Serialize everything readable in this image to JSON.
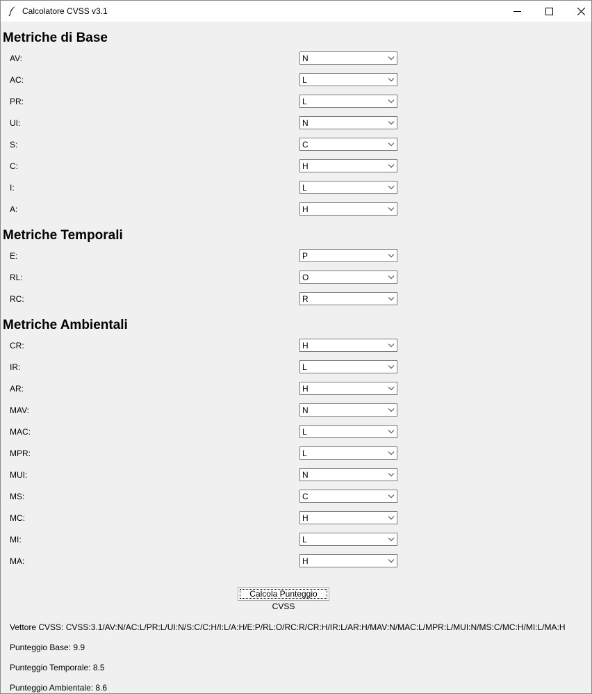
{
  "window": {
    "title": "Calcolatore CVSS v3.1"
  },
  "sections": {
    "base": {
      "heading": "Metriche di Base",
      "fields": [
        {
          "label": "AV:",
          "value": "N"
        },
        {
          "label": "AC:",
          "value": "L"
        },
        {
          "label": "PR:",
          "value": "L"
        },
        {
          "label": "UI:",
          "value": "N"
        },
        {
          "label": "S:",
          "value": "C"
        },
        {
          "label": "C:",
          "value": "H"
        },
        {
          "label": "I:",
          "value": "L"
        },
        {
          "label": "A:",
          "value": "H"
        }
      ]
    },
    "temporal": {
      "heading": "Metriche Temporali",
      "fields": [
        {
          "label": "E:",
          "value": "P"
        },
        {
          "label": "RL:",
          "value": "O"
        },
        {
          "label": "RC:",
          "value": "R"
        }
      ]
    },
    "environmental": {
      "heading": "Metriche Ambientali",
      "fields": [
        {
          "label": "CR:",
          "value": "H"
        },
        {
          "label": "IR:",
          "value": "L"
        },
        {
          "label": "AR:",
          "value": "H"
        },
        {
          "label": "MAV:",
          "value": "N"
        },
        {
          "label": "MAC:",
          "value": "L"
        },
        {
          "label": "MPR:",
          "value": "L"
        },
        {
          "label": "MUI:",
          "value": "N"
        },
        {
          "label": "MS:",
          "value": "C"
        },
        {
          "label": "MC:",
          "value": "H"
        },
        {
          "label": "MI:",
          "value": "L"
        },
        {
          "label": "MA:",
          "value": "H"
        }
      ]
    }
  },
  "actions": {
    "calculate_label": "Calcola Punteggio CVSS"
  },
  "results": {
    "vector": "Vettore CVSS: CVSS:3.1/AV:N/AC:L/PR:L/UI:N/S:C/C:H/I:L/A:H/E:P/RL:O/RC:R/CR:H/IR:L/AR:H/MAV:N/MAC:L/MPR:L/MUI:N/MS:C/MC:H/MI:L/MA:H",
    "base_score": "Punteggio Base: 9.9",
    "temporal_score": "Punteggio Temporale: 8.5",
    "environmental_score": "Punteggio Ambientale: 8.6"
  },
  "icons": {
    "app": "feather-icon",
    "minimize": "minimize-icon",
    "maximize": "maximize-icon",
    "close": "close-icon",
    "dropdown": "chevron-down-icon"
  }
}
